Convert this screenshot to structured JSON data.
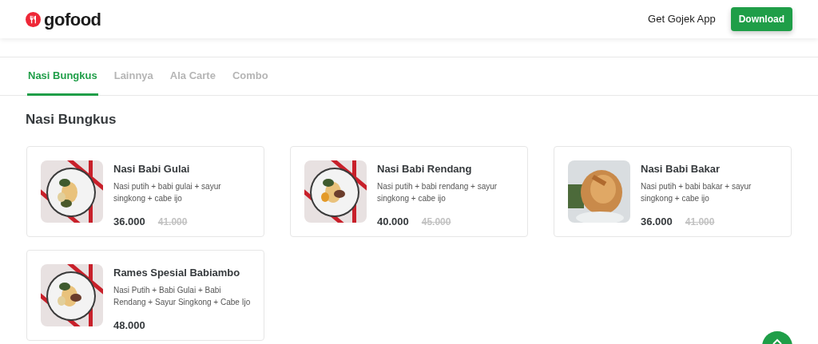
{
  "header": {
    "logo_text": "gofood",
    "app_link": "Get Gojek App",
    "download_button": "Download"
  },
  "tabs": [
    {
      "label": "Nasi Bungkus",
      "selected": true
    },
    {
      "label": "Lainnya",
      "selected": false
    },
    {
      "label": "Ala Carte",
      "selected": false
    },
    {
      "label": "Combo",
      "selected": false
    }
  ],
  "section_title": "Nasi Bungkus",
  "items": [
    {
      "name": "Nasi Babi Gulai",
      "description": "Nasi putih + babi gulai + sayur singkong + cabe ijo",
      "price": "36.000",
      "original_price": "41.000"
    },
    {
      "name": "Nasi Babi Rendang",
      "description": "Nasi putih + babi rendang + sayur singkong + cabe ijo",
      "price": "40.000",
      "original_price": "45.000"
    },
    {
      "name": "Nasi Babi Bakar",
      "description": "Nasi putih + babi bakar + sayur singkong + cabe ijo",
      "price": "36.000",
      "original_price": "41.000"
    },
    {
      "name": "Rames Spesial Babiambo",
      "description": "Nasi Putih + Babi Gulai + Babi Rendang + Sayur Singkong + Cabe Ijo",
      "price": "48.000"
    }
  ]
}
